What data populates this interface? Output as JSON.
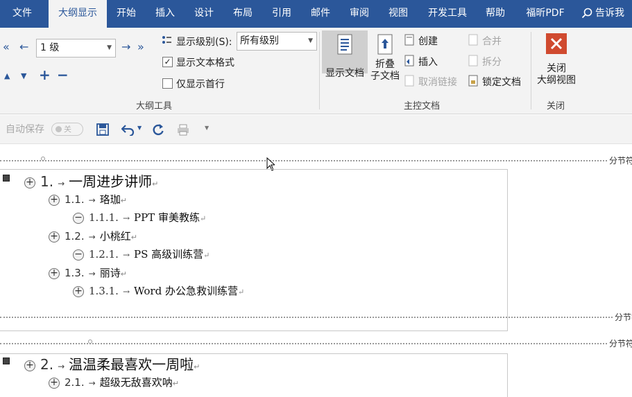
{
  "tabs": [
    {
      "label": "文件",
      "active": false
    },
    {
      "label": "大纲显示",
      "active": true
    },
    {
      "label": "开始",
      "active": false
    },
    {
      "label": "插入",
      "active": false
    },
    {
      "label": "设计",
      "active": false
    },
    {
      "label": "布局",
      "active": false
    },
    {
      "label": "引用",
      "active": false
    },
    {
      "label": "邮件",
      "active": false
    },
    {
      "label": "审阅",
      "active": false
    },
    {
      "label": "视图",
      "active": false
    },
    {
      "label": "开发工具",
      "active": false
    },
    {
      "label": "帮助",
      "active": false
    },
    {
      "label": "福昕PDF",
      "active": false
    }
  ],
  "tell_me": "告诉我",
  "outline_tools": {
    "group_label": "大纲工具",
    "level_value": "1 级",
    "show_level_label": "显示级别(S):",
    "show_level_value": "所有级别",
    "show_text_format": "显示文本格式",
    "show_text_format_checked": true,
    "first_line_only": "仅显示首行",
    "first_line_only_checked": false
  },
  "master_doc": {
    "group_label": "主控文档",
    "show_document": "显示文档",
    "collapse_sub_1": "折叠",
    "collapse_sub_2": "子文档",
    "create": "创建",
    "insert": "插入",
    "unlink": "取消链接",
    "merge": "合并",
    "split": "拆分",
    "lock_document": "锁定文档"
  },
  "close_group": {
    "group_label": "关闭",
    "close_outline_1": "关闭",
    "close_outline_2": "大纲视图"
  },
  "qat": {
    "autosave": "自动保存",
    "toggle": "关"
  },
  "section_break": "分节符",
  "outline": [
    {
      "level": 1,
      "number": "1.",
      "text": "一周进步讲师",
      "sym": "+"
    },
    {
      "level": 2,
      "number": "1.1.",
      "text": "珞珈",
      "sym": "+"
    },
    {
      "level": 3,
      "number": "1.1.1.",
      "text": "PPT 审美教练",
      "sym": "−"
    },
    {
      "level": 2,
      "number": "1.2.",
      "text": "小桃红",
      "sym": "+"
    },
    {
      "level": 3,
      "number": "1.2.1.",
      "text": "PS 高级训练营",
      "sym": "−"
    },
    {
      "level": 2,
      "number": "1.3.",
      "text": "丽诗",
      "sym": "+"
    },
    {
      "level": 3,
      "number": "1.3.1.",
      "text": "Word 办公急救训练营",
      "sym": "+"
    },
    {
      "level": 1,
      "number": "2.",
      "text": "温温柔最喜欢一周啦",
      "sym": "+"
    },
    {
      "level": 2,
      "number": "2.1.",
      "text": "超级无敌喜欢呐",
      "sym": "+"
    }
  ],
  "colors": {
    "accent": "#2b579a",
    "ribbon_bg": "#f3f3f3",
    "close_red": "#d04a2f"
  }
}
